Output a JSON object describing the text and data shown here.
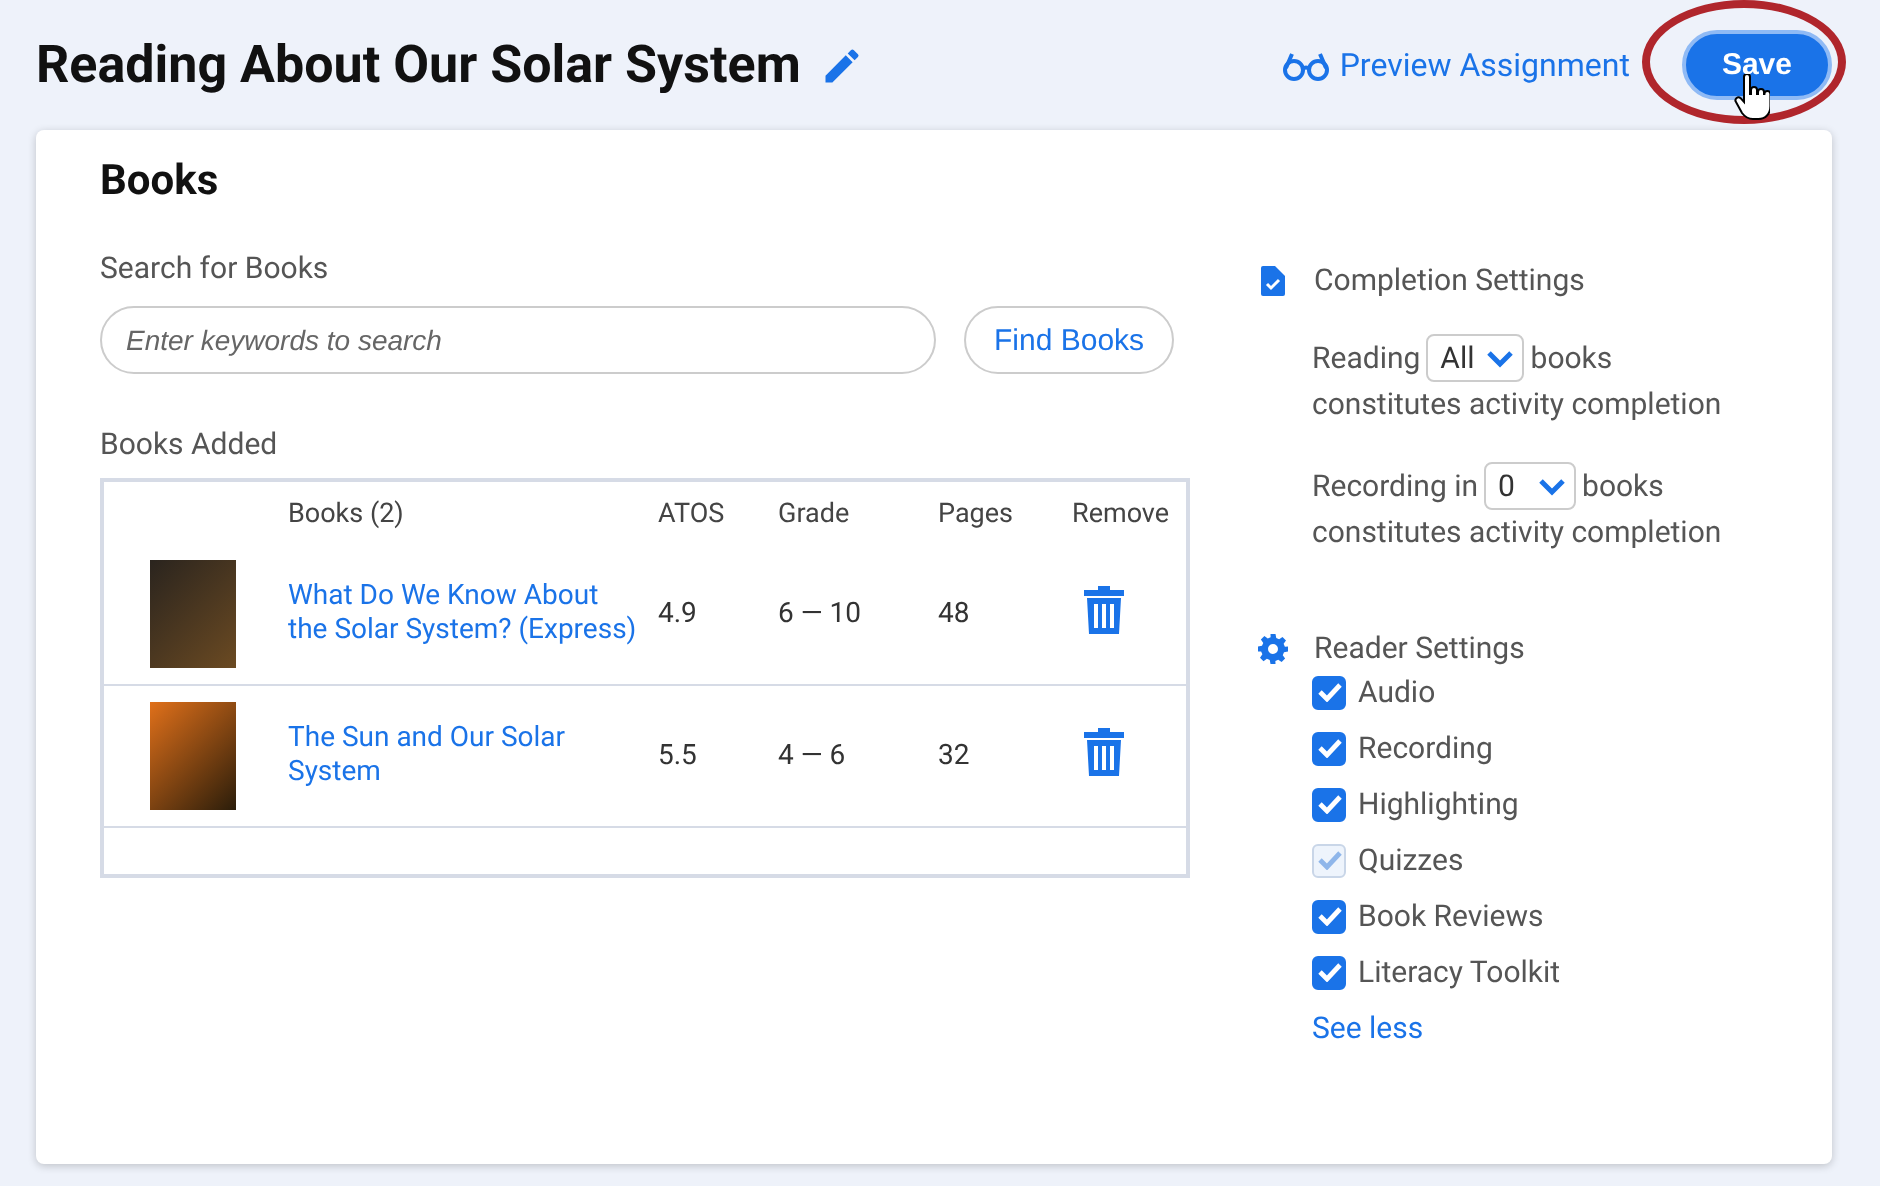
{
  "header": {
    "title": "Reading About Our Solar System",
    "preview_link": "Preview Assignment",
    "save_button": {
      "label": "Save",
      "highlighted": true
    }
  },
  "books_panel": {
    "heading": "Books",
    "search_label": "Search for Books",
    "search": {
      "placeholder": "Enter keywords to search"
    },
    "find_button": "Find Books",
    "added_label": "Books Added",
    "table": {
      "columns": [
        "Books (2)",
        "ATOS",
        "Grade",
        "Pages",
        "Remove"
      ],
      "rows": [
        {
          "title": "What Do We Know About the Solar System? (Express)",
          "atos": "4.9",
          "grade": "6 — 10",
          "pages": "48"
        },
        {
          "title": "The Sun and Our Solar System",
          "atos": "5.5",
          "grade": "4 — 6",
          "pages": "32"
        }
      ]
    }
  },
  "completion_settings": {
    "heading": "Completion Settings",
    "rules": [
      {
        "before": "Reading",
        "value": "All",
        "after": "books",
        "line2": "constitutes activity completion"
      },
      {
        "before": "Recording in",
        "value": "0",
        "after": "books",
        "line2": "constitutes activity completion"
      }
    ]
  },
  "reader_settings": {
    "heading": "Reader Settings",
    "options": [
      {
        "label": "Audio",
        "checked": true,
        "disabled": false
      },
      {
        "label": "Recording",
        "checked": true,
        "disabled": false
      },
      {
        "label": "Highlighting",
        "checked": true,
        "disabled": false
      },
      {
        "label": "Quizzes",
        "checked": true,
        "disabled": true
      },
      {
        "label": "Book Reviews",
        "checked": true,
        "disabled": false
      },
      {
        "label": "Literacy Toolkit",
        "checked": true,
        "disabled": false
      }
    ],
    "toggle_link": "See less"
  }
}
